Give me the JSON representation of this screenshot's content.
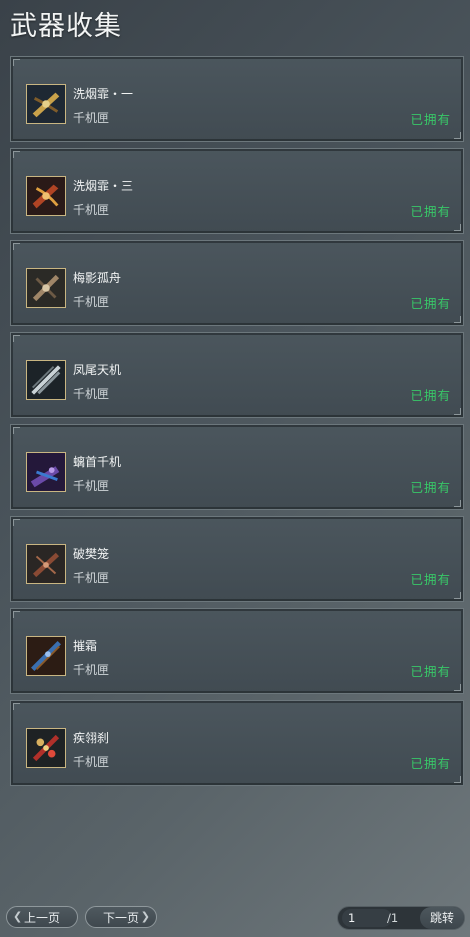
{
  "title": "武器收集",
  "items": [
    {
      "name": "洗烟霏・一",
      "category": "千机匣",
      "status": "已拥有",
      "icon": "weapon-crossbow-gold-icon"
    },
    {
      "name": "洗烟霏・三",
      "category": "千机匣",
      "status": "已拥有",
      "icon": "weapon-crossbow-red-icon"
    },
    {
      "name": "梅影孤舟",
      "category": "千机匣",
      "status": "已拥有",
      "icon": "weapon-crossbow-bronze-icon"
    },
    {
      "name": "凤尾天机",
      "category": "千机匣",
      "status": "已拥有",
      "icon": "weapon-blade-silver-icon"
    },
    {
      "name": "螭首千机",
      "category": "千机匣",
      "status": "已拥有",
      "icon": "weapon-crossbow-purple-icon"
    },
    {
      "name": "破樊笼",
      "category": "千机匣",
      "status": "已拥有",
      "icon": "weapon-crossbow-rust-icon"
    },
    {
      "name": "摧霜",
      "category": "千机匣",
      "status": "已拥有",
      "icon": "weapon-crossbow-blue-icon"
    },
    {
      "name": "疾翎刹",
      "category": "千机匣",
      "status": "已拥有",
      "icon": "weapon-crossbow-crimson-icon"
    }
  ],
  "pagination": {
    "prev_label": "上一页",
    "next_label": "下一页",
    "current_page": "1",
    "total_pages": "/1",
    "jump_label": "跳转"
  },
  "colors": {
    "owned": "#38c768",
    "frame": "#c9b682"
  }
}
